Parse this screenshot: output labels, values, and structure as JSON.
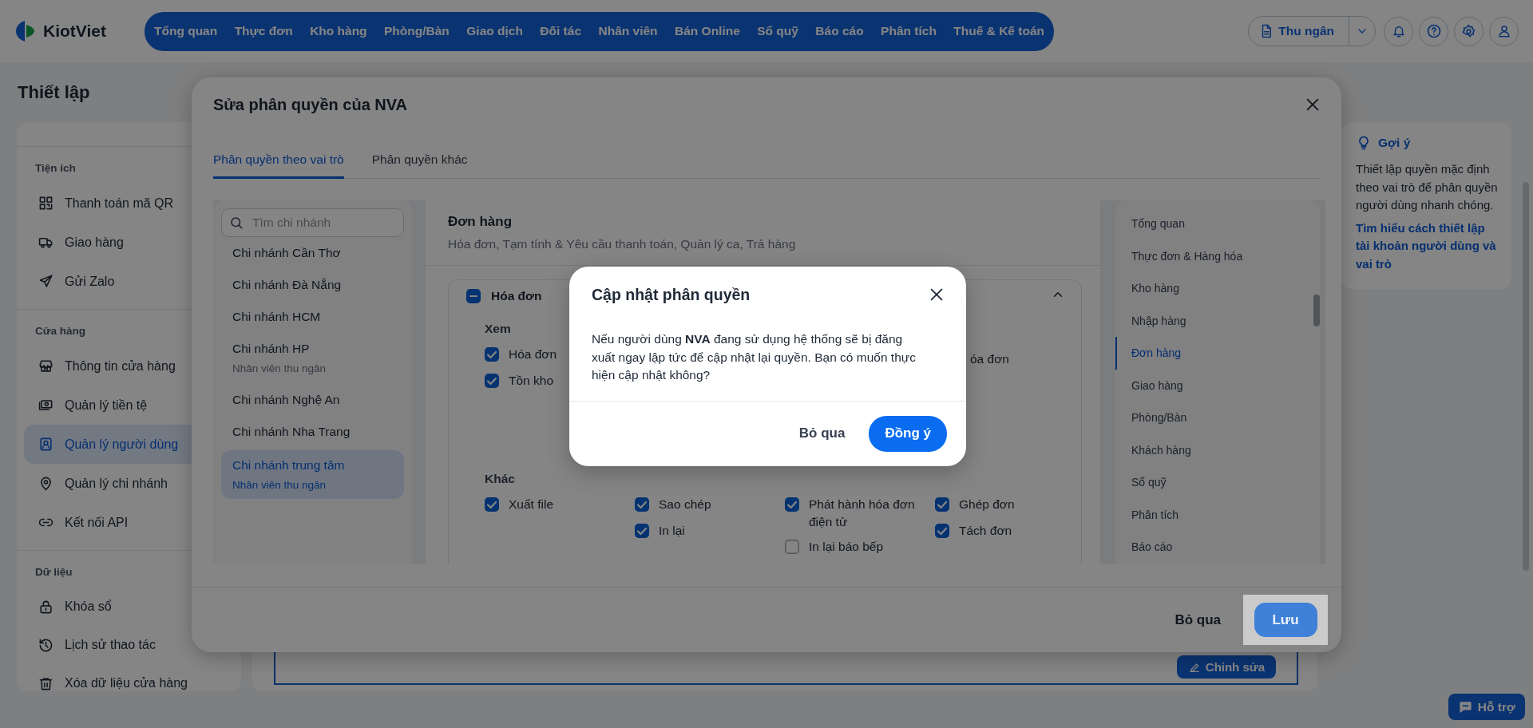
{
  "topbar": {
    "logo": "KiotViet",
    "nav": [
      {
        "label": "Tổng quan"
      },
      {
        "label": "Thực đơn"
      },
      {
        "label": "Kho hàng"
      },
      {
        "label": "Phòng/Bàn"
      },
      {
        "label": "Giao dịch"
      },
      {
        "label": "Đối tác"
      },
      {
        "label": "Nhân viên"
      },
      {
        "label": "Bán Online"
      },
      {
        "label": "Sổ quỹ"
      },
      {
        "label": "Báo cáo"
      },
      {
        "label": "Phân tích"
      },
      {
        "label": "Thuế & Kế toán"
      }
    ],
    "role_menu": "Thu ngân"
  },
  "page_title": "Thiết lập",
  "sidebar": {
    "sections": [
      {
        "heading": "Tiện ích",
        "items": [
          {
            "label": "Thanh toán mã QR",
            "selected": false
          },
          {
            "label": "Giao hàng",
            "selected": false
          },
          {
            "label": "Gửi Zalo",
            "selected": false
          }
        ]
      },
      {
        "heading": "Cửa hàng",
        "items": [
          {
            "label": "Thông tin cửa hàng",
            "selected": false
          },
          {
            "label": "Quản lý tiền tệ",
            "selected": false
          },
          {
            "label": "Quản lý người dùng",
            "selected": true
          },
          {
            "label": "Quản lý chi nhánh",
            "selected": false
          },
          {
            "label": "Kết nối API",
            "selected": false
          }
        ]
      },
      {
        "heading": "Dữ liệu",
        "items": [
          {
            "label": "Khóa sổ",
            "selected": false
          },
          {
            "label": "Lịch sử thao tác",
            "selected": false
          },
          {
            "label": "Xóa dữ liệu cửa hàng",
            "selected": false
          }
        ]
      }
    ]
  },
  "main": {
    "edit_button": "Chỉnh sửa"
  },
  "hint": {
    "title": "Gợi ý",
    "text": "Thiết lập quyền mặc định theo vai trò để phân quyền người dùng nhanh chóng.",
    "link": "Tìm hiểu cách thiết lập tài khoản người dùng và vai trò"
  },
  "support_button": "Hỗ trợ",
  "edit_modal": {
    "title": "Sửa phân quyền của NVA",
    "tabs": [
      {
        "label": "Phân quyền theo vai trò",
        "selected": true
      },
      {
        "label": "Phân quyền khác",
        "selected": false
      }
    ],
    "branch_search": {
      "placeholder": "Tìm chi nhánh"
    },
    "branches": [
      {
        "name": "Chi nhánh Cần Thơ",
        "selected": false
      },
      {
        "name": "Chi nhánh Đà Nẵng",
        "selected": false
      },
      {
        "name": "Chi nhánh HCM",
        "selected": false
      },
      {
        "name": "Chi nhánh HP",
        "role": "Nhân viên thu ngân",
        "selected": false
      },
      {
        "name": "Chi nhánh Nghệ An",
        "selected": false
      },
      {
        "name": "Chi nhánh Nha Trang",
        "selected": false
      },
      {
        "name": "Chi nhánh trung tâm",
        "role": "Nhân viên thu ngân",
        "selected": true
      }
    ],
    "section": {
      "title": "Đơn hàng",
      "subtitle": "Hóa đơn, Tạm tính & Yêu cầu thanh toán, Quản lý ca, Trả hàng"
    },
    "group": {
      "title": "Hóa đơn",
      "indeterminate": true,
      "expanded": true,
      "subgroups": [
        {
          "title": "Xem",
          "columns": [
            {
              "permissions": [
                {
                  "label": "Hóa đơn",
                  "checked": true
                },
                {
                  "label": "Tồn kho",
                  "checked": true
                }
              ]
            }
          ],
          "covered_text": "óa đơn"
        },
        {
          "title": "Khác",
          "columns": [
            {
              "permissions": [
                {
                  "label": "Xuất file",
                  "checked": true
                }
              ]
            },
            {
              "permissions": [
                {
                  "label": "Sao chép",
                  "checked": true
                },
                {
                  "label": "In lại",
                  "checked": true
                }
              ]
            },
            {
              "permissions": [
                {
                  "label": "Phát hành hóa đơn điện tử",
                  "checked": true
                },
                {
                  "label": "In lại báo bếp",
                  "checked": false
                }
              ]
            },
            {
              "permissions": [
                {
                  "label": "Ghép đơn",
                  "checked": true
                },
                {
                  "label": "Tách đơn",
                  "checked": true
                }
              ]
            }
          ]
        }
      ]
    },
    "nav": [
      {
        "label": "Tổng quan",
        "selected": false
      },
      {
        "label": "Thực đơn & Hàng hóa",
        "selected": false
      },
      {
        "label": "Kho hàng",
        "selected": false
      },
      {
        "label": "Nhập hàng",
        "selected": false
      },
      {
        "label": "Đơn hàng",
        "selected": true
      },
      {
        "label": "Giao hàng",
        "selected": false
      },
      {
        "label": "Phòng/Bàn",
        "selected": false
      },
      {
        "label": "Khách hàng",
        "selected": false
      },
      {
        "label": "Sổ quỹ",
        "selected": false
      },
      {
        "label": "Phân tích",
        "selected": false
      },
      {
        "label": "Báo cáo",
        "selected": false
      }
    ],
    "cancel_button": "Bỏ qua",
    "save_button": "Lưu"
  },
  "confirm_dialog": {
    "title": "Cập nhật phân quyền",
    "message": "Nếu người dùng **NVA** đang sử dụng hệ thống sẽ bị đăng xuất ngay lập tức để cập nhật lại quyền. Bạn có muốn thực hiện cập nhật không?",
    "cancel_button": "Bỏ qua",
    "confirm_button": "Đồng ý"
  }
}
